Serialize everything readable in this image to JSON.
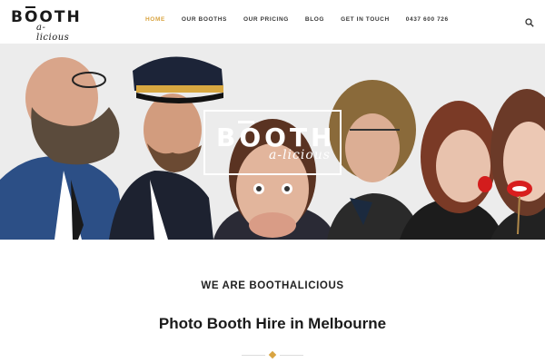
{
  "header": {
    "logo": {
      "main": "BOOTH",
      "sub": "a-licious"
    },
    "nav": [
      {
        "label": "HOME",
        "active": true
      },
      {
        "label": "OUR BOOTHS",
        "active": false
      },
      {
        "label": "OUR PRICING",
        "active": false
      },
      {
        "label": "BLOG",
        "active": false
      },
      {
        "label": "GET IN TOUCH",
        "active": false
      },
      {
        "label": "0437 600 726",
        "active": false
      }
    ],
    "search_icon": "search-icon"
  },
  "hero": {
    "logo": {
      "main": "BOOTH",
      "sub": "a-licious"
    }
  },
  "content": {
    "intro_heading": "WE ARE BOOTHALICIOUS",
    "main_heading": "Photo Booth Hire in Melbourne"
  },
  "colors": {
    "accent": "#d9a441",
    "text": "#1a1a1a",
    "nav_text": "#3a3a3a"
  }
}
